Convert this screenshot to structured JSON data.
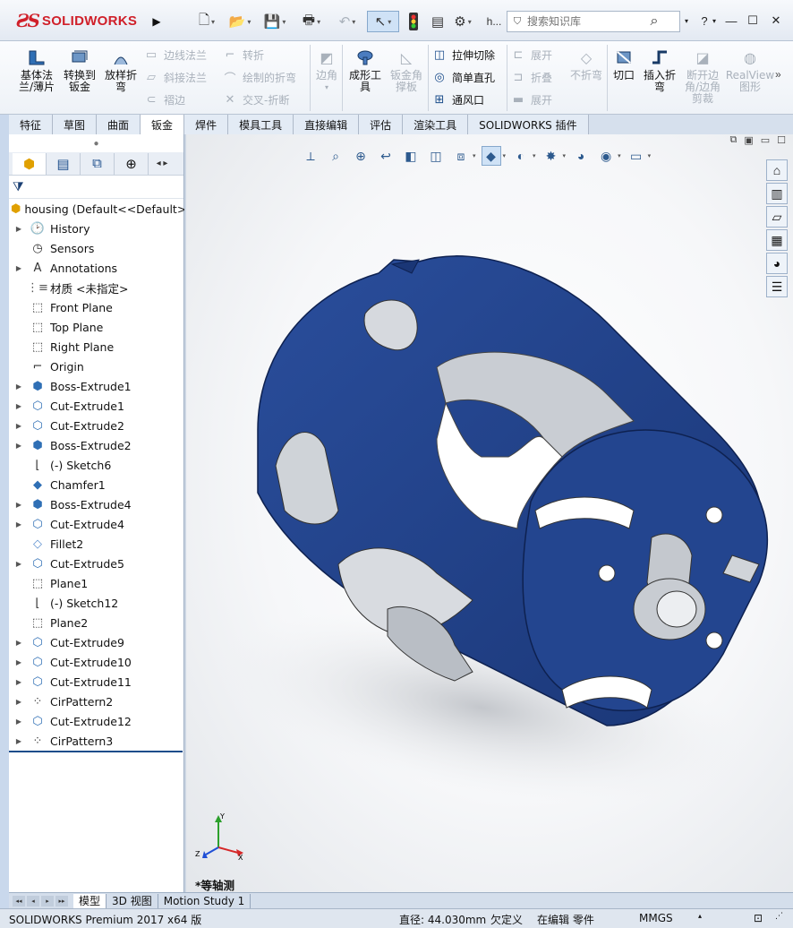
{
  "app": {
    "logo_text": "SOLIDWORKS",
    "doc_name_short": "h..."
  },
  "search": {
    "placeholder": "搜索知识库"
  },
  "command_manager": {
    "large_buttons": [
      {
        "label": "基体法\n兰/薄片",
        "icon": "base-flange-icon",
        "enabled": true
      },
      {
        "label": "转换到\n钣金",
        "icon": "convert-to-sheet-metal-icon",
        "enabled": true
      },
      {
        "label": "放样折\n弯",
        "icon": "lofted-bend-icon",
        "enabled": true
      },
      {
        "label": "边角",
        "icon": "corners-icon",
        "enabled": false
      },
      {
        "label": "成形工\n具",
        "icon": "forming-tool-icon",
        "enabled": true
      },
      {
        "label": "钣金角\n撑板",
        "icon": "sheet-metal-gusset-icon",
        "enabled": false
      },
      {
        "label": "切口",
        "icon": "rip-icon",
        "enabled": true
      },
      {
        "label": "插入折\n弯",
        "icon": "insert-bends-icon",
        "enabled": true
      },
      {
        "label": "断开边\n角/边角\n剪裁",
        "icon": "break-corner-icon",
        "enabled": false
      },
      {
        "label": "RealView\n图形",
        "icon": "realview-icon",
        "enabled": false
      }
    ],
    "small_buttons": [
      {
        "label": "边线法兰",
        "icon": "edge-flange-icon",
        "enabled": false
      },
      {
        "label": "斜接法兰",
        "icon": "miter-flange-icon",
        "enabled": false
      },
      {
        "label": "褶边",
        "icon": "hem-icon",
        "enabled": false
      },
      {
        "label": "转折",
        "icon": "jog-icon",
        "enabled": false
      },
      {
        "label": "绘制的折弯",
        "icon": "sketched-bend-icon",
        "enabled": false
      },
      {
        "label": "交叉-折断",
        "icon": "cross-break-icon",
        "enabled": false
      },
      {
        "label": "拉伸切除",
        "icon": "extruded-cut-icon",
        "enabled": true
      },
      {
        "label": "简单直孔",
        "icon": "simple-hole-icon",
        "enabled": true
      },
      {
        "label": "通风口",
        "icon": "vent-icon",
        "enabled": true
      },
      {
        "label": "展开",
        "icon": "unfold-icon",
        "enabled": false
      },
      {
        "label": "折叠",
        "icon": "fold-icon",
        "enabled": false
      },
      {
        "label": "展开",
        "icon": "flatten-icon",
        "enabled": false
      },
      {
        "label": "不折弯",
        "icon": "no-bends-icon",
        "enabled": false
      }
    ]
  },
  "tabs": [
    {
      "label": "特征",
      "active": false
    },
    {
      "label": "草图",
      "active": false
    },
    {
      "label": "曲面",
      "active": false
    },
    {
      "label": "钣金",
      "active": true
    },
    {
      "label": "焊件",
      "active": false
    },
    {
      "label": "模具工具",
      "active": false
    },
    {
      "label": "直接编辑",
      "active": false
    },
    {
      "label": "评估",
      "active": false
    },
    {
      "label": "渲染工具",
      "active": false
    },
    {
      "label": "SOLIDWORKS 插件",
      "active": false
    }
  ],
  "feature_tree": {
    "root": "housing  (Default<<Default>_",
    "items": [
      {
        "label": "History",
        "icon": "history-icon",
        "expandable": true
      },
      {
        "label": "Sensors",
        "icon": "sensors-icon",
        "expandable": false
      },
      {
        "label": "Annotations",
        "icon": "annotations-icon",
        "expandable": true
      },
      {
        "label": "材质 <未指定>",
        "icon": "material-icon",
        "expandable": false
      },
      {
        "label": "Front Plane",
        "icon": "plane-icon",
        "expandable": false
      },
      {
        "label": "Top Plane",
        "icon": "plane-icon",
        "expandable": false
      },
      {
        "label": "Right Plane",
        "icon": "plane-icon",
        "expandable": false
      },
      {
        "label": "Origin",
        "icon": "origin-icon",
        "expandable": false
      },
      {
        "label": "Boss-Extrude1",
        "icon": "boss-extrude-icon",
        "expandable": true
      },
      {
        "label": "Cut-Extrude1",
        "icon": "cut-extrude-icon",
        "expandable": true
      },
      {
        "label": "Cut-Extrude2",
        "icon": "cut-extrude-icon",
        "expandable": true
      },
      {
        "label": "Boss-Extrude2",
        "icon": "boss-extrude-icon",
        "expandable": true
      },
      {
        "label": "(-) Sketch6",
        "icon": "sketch-icon",
        "expandable": false
      },
      {
        "label": "Chamfer1",
        "icon": "chamfer-icon",
        "expandable": false
      },
      {
        "label": "Boss-Extrude4",
        "icon": "boss-extrude-icon",
        "expandable": true
      },
      {
        "label": "Cut-Extrude4",
        "icon": "cut-extrude-icon",
        "expandable": true
      },
      {
        "label": "Fillet2",
        "icon": "fillet-icon",
        "expandable": false
      },
      {
        "label": "Cut-Extrude5",
        "icon": "cut-extrude-icon",
        "expandable": true
      },
      {
        "label": "Plane1",
        "icon": "plane-icon",
        "expandable": false
      },
      {
        "label": "(-) Sketch12",
        "icon": "sketch-icon",
        "expandable": false
      },
      {
        "label": "Plane2",
        "icon": "plane-icon",
        "expandable": false
      },
      {
        "label": "Cut-Extrude9",
        "icon": "cut-extrude-icon",
        "expandable": true
      },
      {
        "label": "Cut-Extrude10",
        "icon": "cut-extrude-icon",
        "expandable": true
      },
      {
        "label": "Cut-Extrude11",
        "icon": "cut-extrude-icon",
        "expandable": true
      },
      {
        "label": "CirPattern2",
        "icon": "circular-pattern-icon",
        "expandable": true
      },
      {
        "label": "Cut-Extrude12",
        "icon": "cut-extrude-icon",
        "expandable": true
      },
      {
        "label": "CirPattern3",
        "icon": "circular-pattern-icon",
        "expandable": true
      }
    ]
  },
  "viewport": {
    "view_name": "*等轴测",
    "model_color": "#1f3f8c",
    "triad_labels": {
      "x": "X",
      "y": "Y",
      "z": "Z"
    }
  },
  "bottom_tabs": [
    {
      "label": "模型",
      "active": true
    },
    {
      "label": "3D 视图",
      "active": false
    },
    {
      "label": "Motion Study 1",
      "active": false
    }
  ],
  "status": {
    "product": "SOLIDWORKS Premium 2017 x64 版",
    "measure": "直径: 44.030mm",
    "defined": "欠定义",
    "mode": "在编辑 零件",
    "units": "MMGS"
  },
  "colors": {
    "accent": "#1a4c8a",
    "logo_red": "#d0202a"
  }
}
